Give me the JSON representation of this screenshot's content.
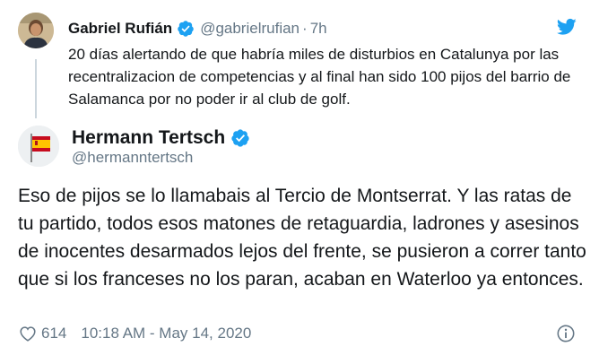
{
  "quoted_tweet": {
    "name": "Gabriel Rufián",
    "handle": "@gabrielrufian",
    "separator": "·",
    "time": "7h",
    "text": "20 días alertando de que habría miles de disturbios en Catalunya por las recentralizacion de competencias y al final han sido 100 pijos del barrio de Salamanca por no poder ir al club de golf."
  },
  "reply_tweet": {
    "name": "Hermann Tertsch",
    "handle": "@hermanntertsch",
    "text": "Eso de pijos se lo llamabais al Tercio de Montserrat. Y las ratas de tu partido, todos esos matones de retaguardia, ladrones y asesinos de inocentes desarmados lejos del frente, se pusieron a correr tanto que si los franceses no los paran, acaban en Waterloo ya entonces.",
    "likes": "614",
    "timestamp": "10:18 AM - May 14, 2020"
  },
  "icons": {
    "verified": "verified-badge-icon",
    "brand": "twitter-bird-icon",
    "like": "heart-icon",
    "info": "info-icon"
  },
  "colors": {
    "verified": "#1da1f2",
    "brand": "#1da1f2",
    "secondary_text": "#657786",
    "thread_line": "#ccd6dd"
  }
}
